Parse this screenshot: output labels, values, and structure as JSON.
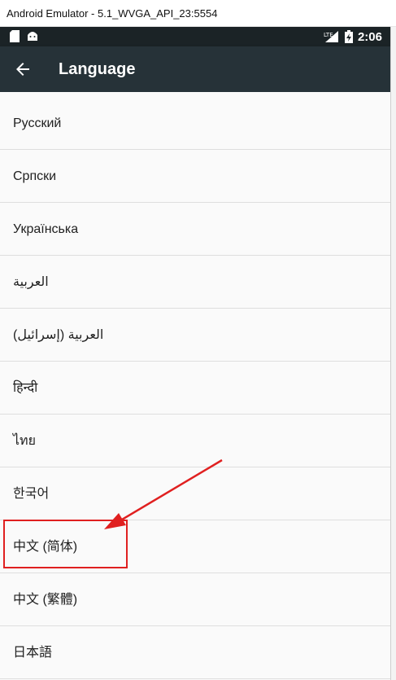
{
  "window": {
    "title": "Android Emulator - 5.1_WVGA_API_23:5554"
  },
  "status_bar": {
    "time": "2:06",
    "network_label": "LTE",
    "accent": "#1b2326"
  },
  "app_bar": {
    "title": "Language",
    "background": "#263238"
  },
  "languages": [
    "Русский",
    "Српски",
    "Українська",
    "العربية",
    "العربية (إسرائيل)",
    "हिन्दी",
    "ไทย",
    "한국어",
    "中文 (简体)",
    "中文 (繁體)",
    "日本語"
  ],
  "annotation": {
    "highlighted_item": "中文 (简体)",
    "color": "#e02020"
  }
}
